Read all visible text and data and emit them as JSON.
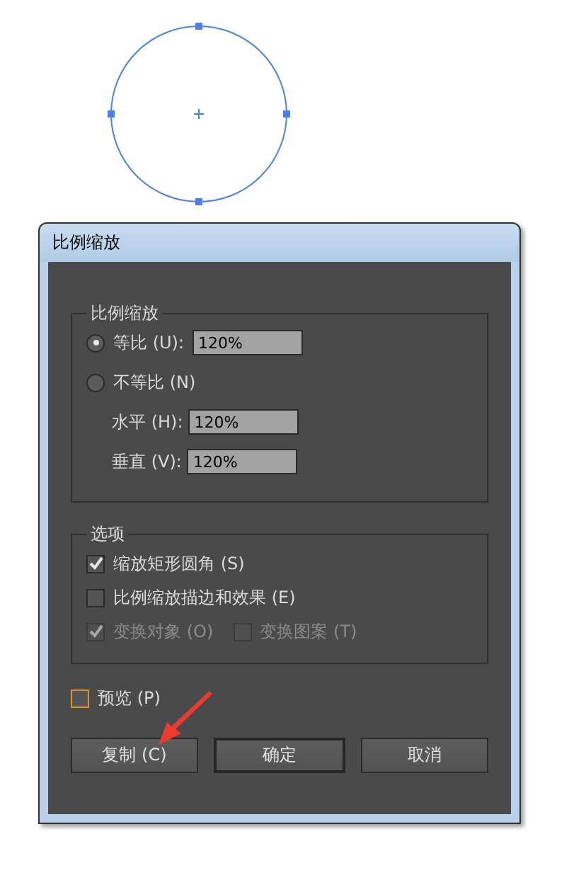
{
  "dialog": {
    "title": "比例缩放"
  },
  "scale_group": {
    "title": "比例缩放",
    "radios": [
      {
        "label": "等比 (U):",
        "selected": true,
        "value": "120%"
      },
      {
        "label": "不等比 (N)",
        "selected": false
      }
    ],
    "fields": [
      {
        "label": "水平 (H):",
        "value": "120%"
      },
      {
        "label": "垂直 (V):",
        "value": "120%"
      }
    ]
  },
  "options_group": {
    "title": "选项",
    "rows": [
      {
        "items": [
          {
            "label": "缩放矩形圆角 (S)",
            "checked": true,
            "disabled": false
          }
        ]
      },
      {
        "items": [
          {
            "label": "比例缩放描边和效果 (E)",
            "checked": false,
            "disabled": false
          }
        ]
      },
      {
        "items": [
          {
            "label": "变换对象 (O)",
            "checked": true,
            "disabled": true
          },
          {
            "label": "变换图案 (T)",
            "checked": false,
            "disabled": true
          }
        ]
      }
    ]
  },
  "preview": {
    "label": "预览 (P)",
    "checked": false
  },
  "buttons": [
    {
      "label": "复制 (C)",
      "default": false
    },
    {
      "label": "确定",
      "default": true
    },
    {
      "label": "取消",
      "default": false
    }
  ]
}
